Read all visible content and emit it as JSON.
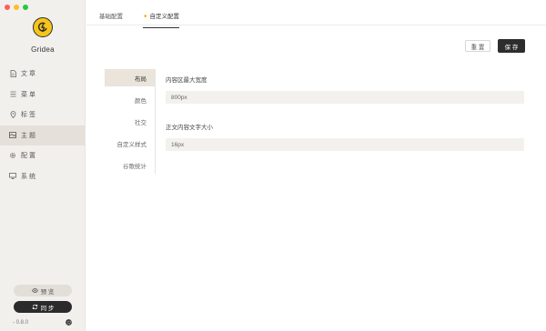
{
  "app": {
    "name": "Gridea",
    "version": "- 0.8.0"
  },
  "sidebar": {
    "items": [
      {
        "label": "文 章",
        "icon": "document-icon"
      },
      {
        "label": "菜 单",
        "icon": "list-icon"
      },
      {
        "label": "标 签",
        "icon": "tag-icon"
      },
      {
        "label": "主 题",
        "icon": "theme-icon"
      },
      {
        "label": "配 置",
        "icon": "gear-icon"
      },
      {
        "label": "系 统",
        "icon": "monitor-icon"
      }
    ],
    "active_index": 3,
    "preview_label": "预 览",
    "sync_label": "同 步"
  },
  "tabs": [
    {
      "label": "基础配置"
    },
    {
      "label": "自定义配置"
    }
  ],
  "toolbar": {
    "reset_label": "重 置",
    "save_label": "保 存"
  },
  "sub_menu": [
    {
      "label": "布局"
    },
    {
      "label": "颜色"
    },
    {
      "label": "社交"
    },
    {
      "label": "自定义样式"
    },
    {
      "label": "谷歌统计"
    }
  ],
  "form": {
    "fields": [
      {
        "label": "内容区最大宽度",
        "value": "800px"
      },
      {
        "label": "正文内容文字大小",
        "value": "16px"
      }
    ]
  },
  "colors": {
    "sidebar_bg": "#f2f0ed",
    "active_bg": "#e5e1da",
    "primary": "#2d2d2d",
    "logo_yellow": "#f6c51c"
  }
}
